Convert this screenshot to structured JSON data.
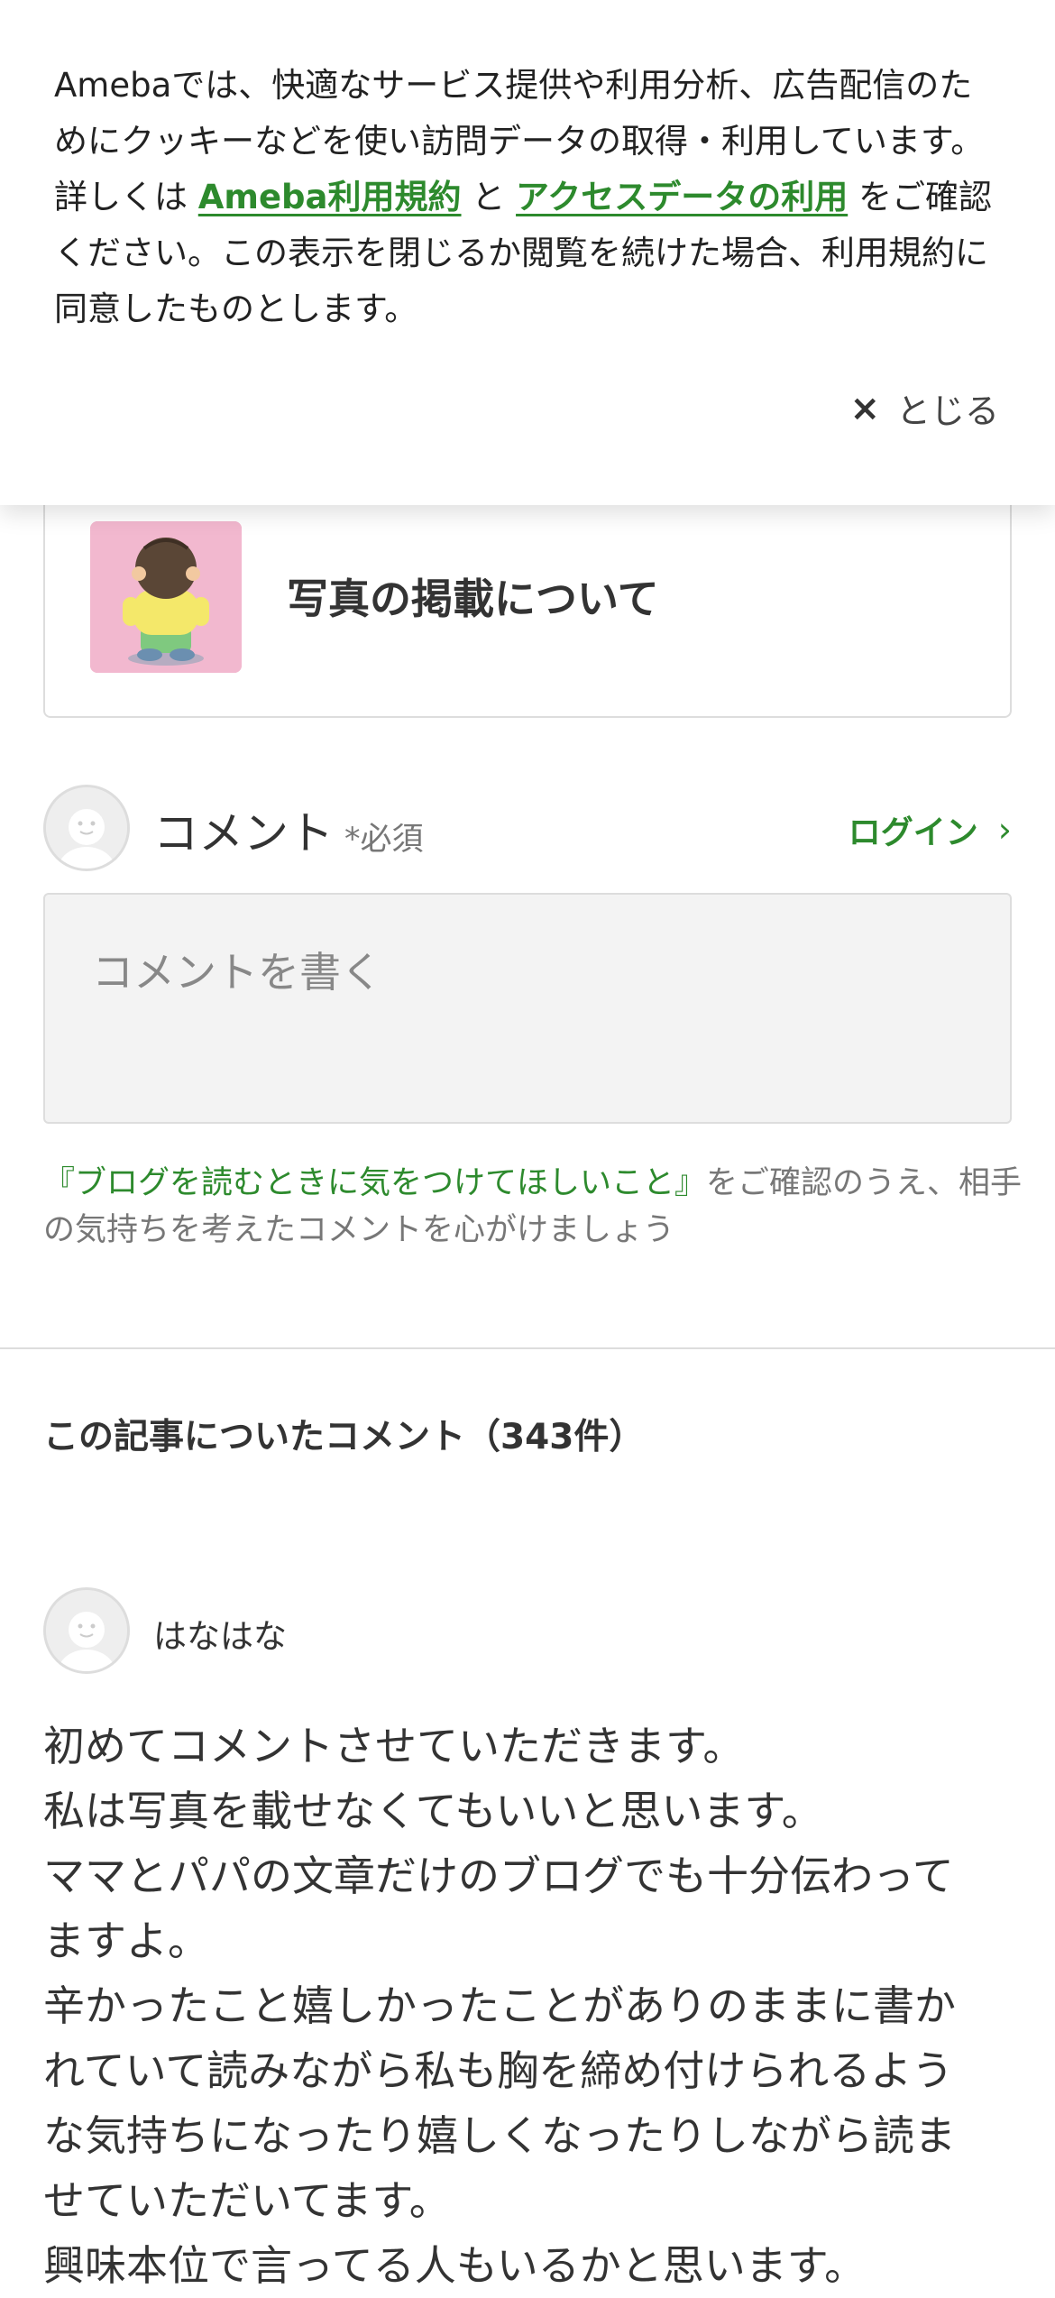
{
  "cookie_banner": {
    "text_part1": "Amebaでは、快適なサービス提供や利用分析、広告配信のためにクッキーなどを使い訪問データの取得・利用しています。詳しくは ",
    "link_terms": "Ameba利用規約",
    "text_and": " と ",
    "link_access": "アクセスデータの利用",
    "text_part2": " をご確認ください。この表示を閉じるか閲覧を続けた場合、利用規約に同意したものとします。",
    "close_label": "とじる",
    "close_icon": "×"
  },
  "related_article": {
    "title": "写真の掲載について"
  },
  "comment_form": {
    "label": "コメント",
    "required": "*必須",
    "login_label": "ログイン",
    "login_chevron": "›",
    "placeholder": "コメントを書く",
    "notice_link": "『ブログを読むときに気をつけてほしいこと』",
    "notice_text": "をご確認のうえ、相手の気持ちを考えたコメントを心がけましょう"
  },
  "comments": {
    "heading": "この記事についたコメント（343件）",
    "items": [
      {
        "author": "はなはな",
        "lines": [
          "初めてコメントさせていただきます。",
          "私は写真を載せなくてもいいと思います。",
          "ママとパパの文章だけのブログでも十分伝わって",
          "ますよ。",
          "辛かったこと嬉しかったことがありのままに書か",
          "れていて読みながら私も胸を締め付けられるよう",
          "な気持ちになったり嬉しくなったりしながら読ま",
          "せていただいてます。",
          "興味本位で言ってる人もいるかと思います。"
        ]
      }
    ]
  },
  "colors": {
    "accent_green": "#2d8a2d",
    "thumb_bg": "#f2b8cf"
  }
}
